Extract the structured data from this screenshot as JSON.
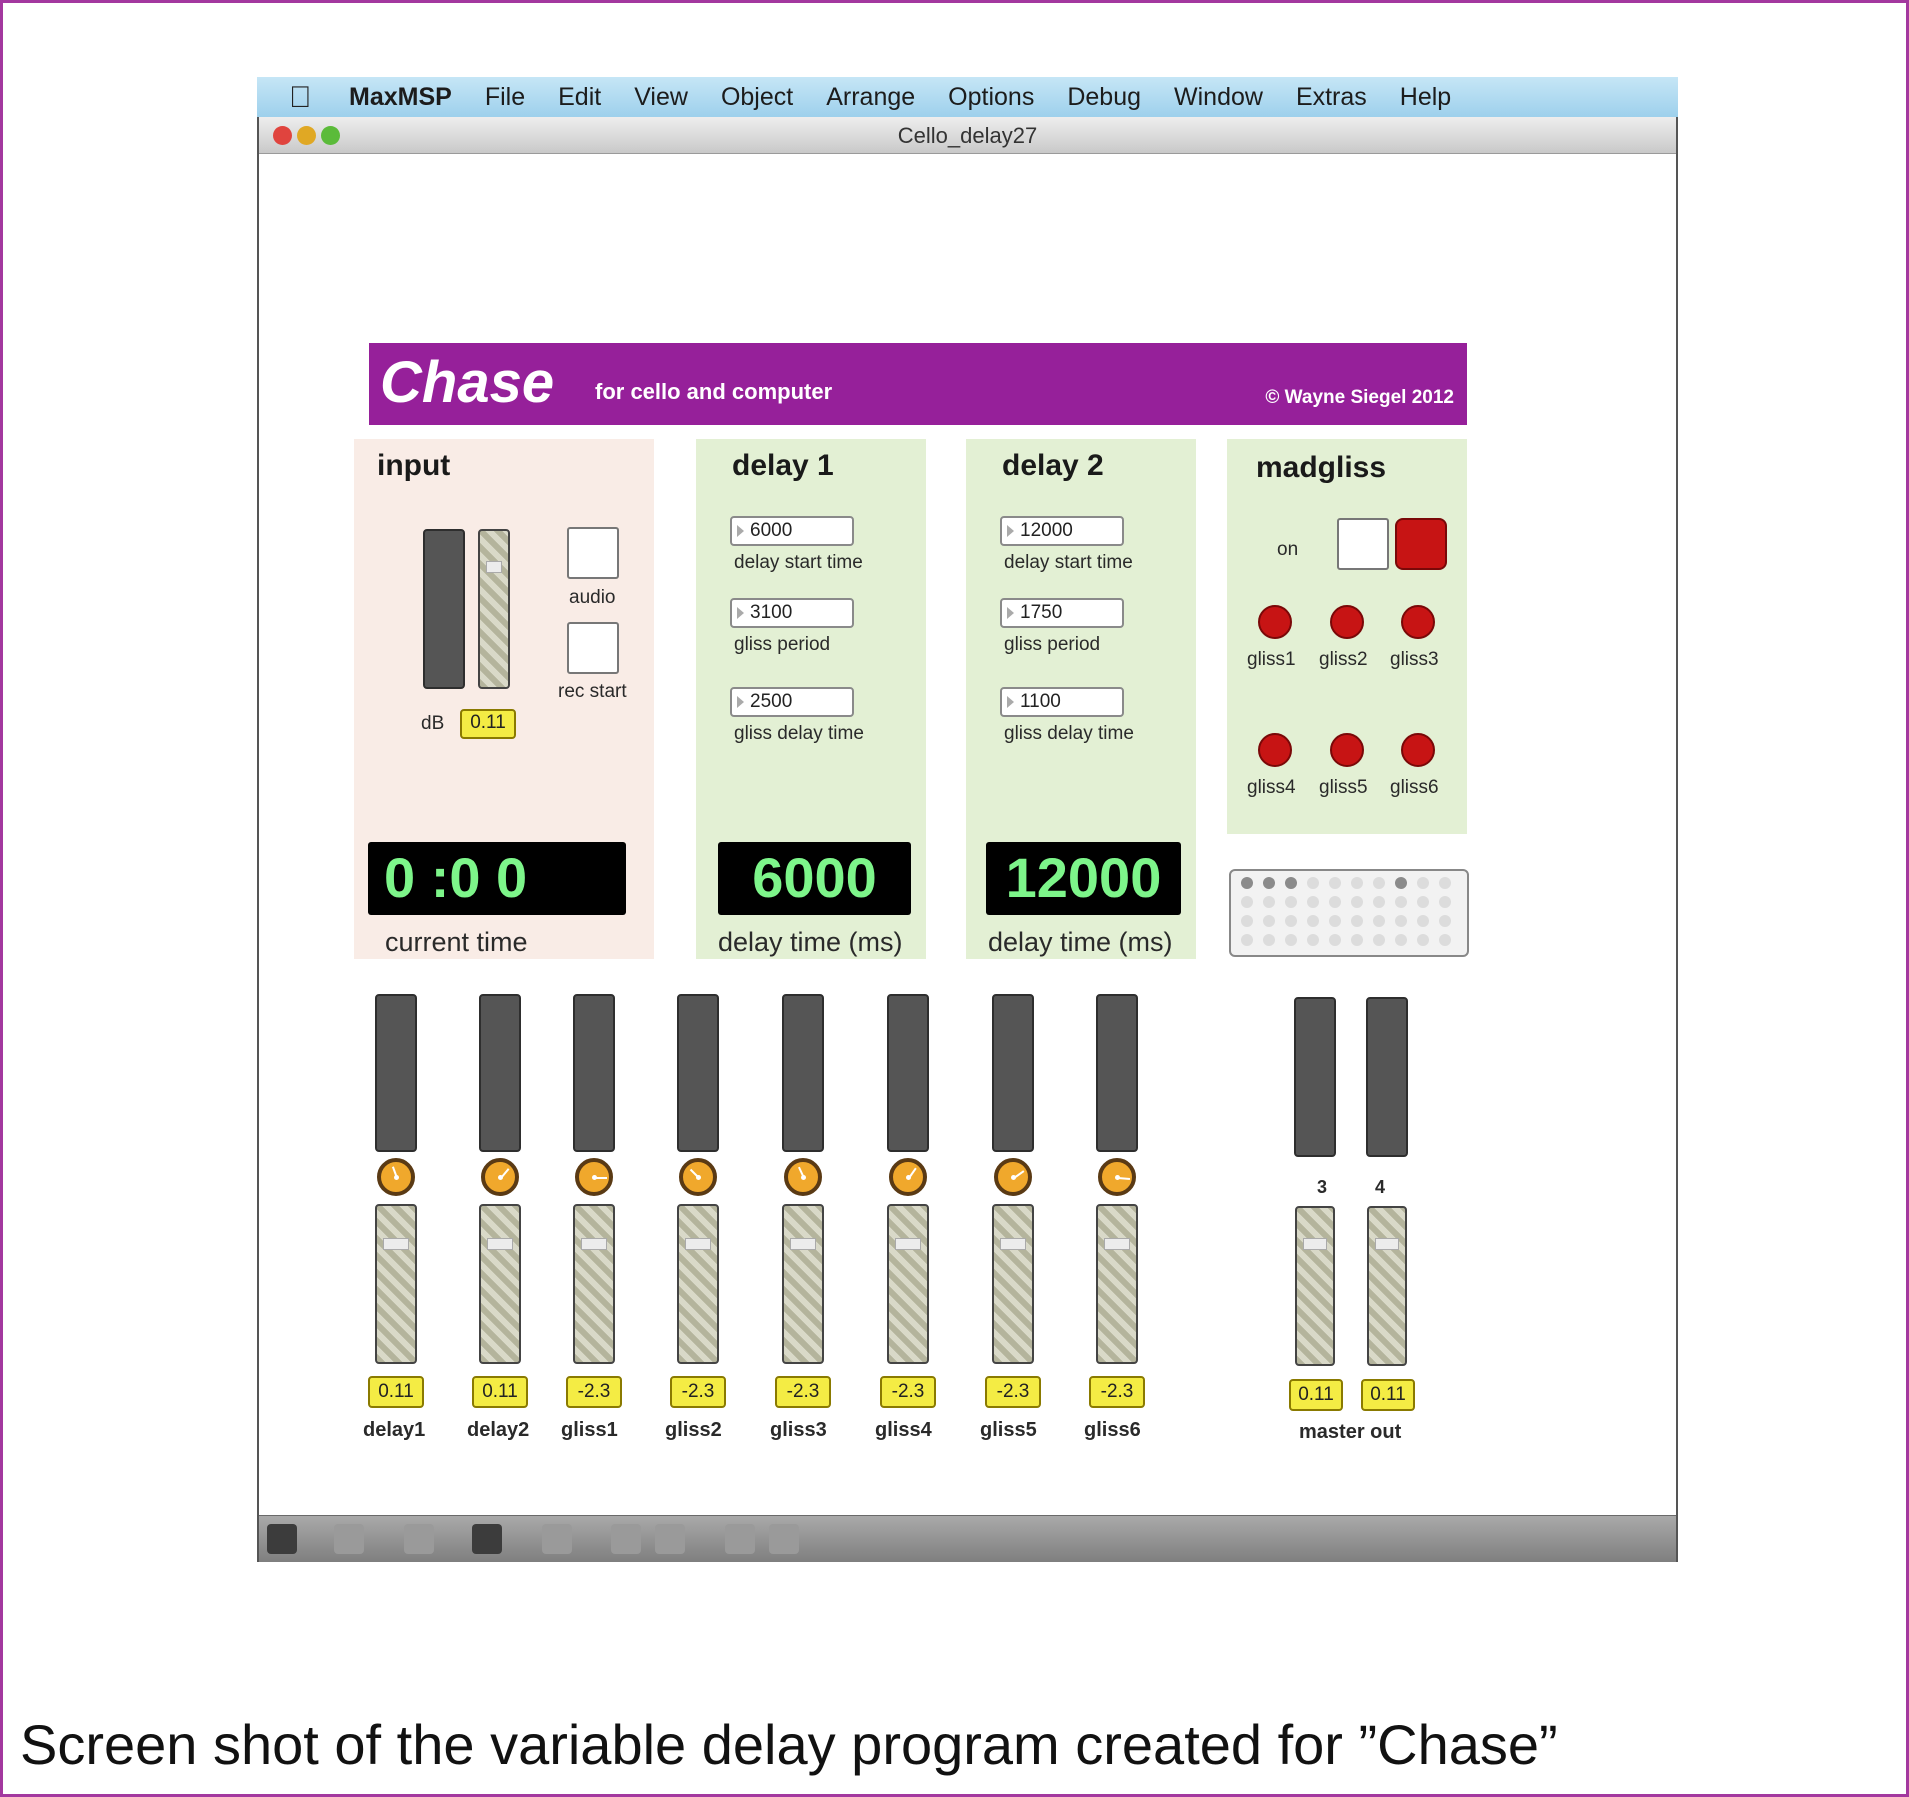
{
  "menubar": {
    "app": "MaxMSP",
    "items": [
      "File",
      "Edit",
      "View",
      "Object",
      "Arrange",
      "Options",
      "Debug",
      "Window",
      "Extras",
      "Help"
    ]
  },
  "window": {
    "title": "Cello_delay27"
  },
  "banner": {
    "title": "Chase",
    "subtitle": "for cello and computer",
    "copyright": "© Wayne Siegel 2012"
  },
  "input": {
    "heading": "input",
    "db_label": "dB",
    "db_value": "0.11",
    "audio_label": "audio",
    "rec_label": "rec start",
    "time_display": "0 :0  0",
    "time_label": "current time"
  },
  "delay1": {
    "heading": "delay 1",
    "start": "6000",
    "start_label": "delay start time",
    "period": "3100",
    "period_label": "gliss period",
    "gdelay": "2500",
    "gdelay_label": "gliss delay time",
    "display": "6000",
    "display_label": "delay time (ms)"
  },
  "delay2": {
    "heading": "delay 2",
    "start": "12000",
    "start_label": "delay start time",
    "period": "1750",
    "period_label": "gliss period",
    "gdelay": "1100",
    "gdelay_label": "gliss delay time",
    "display": "12000",
    "display_label": "delay time (ms)"
  },
  "madgliss": {
    "heading": "madgliss",
    "on_label": "on",
    "buttons": [
      "gliss1",
      "gliss2",
      "gliss3",
      "gliss4",
      "gliss5",
      "gliss6"
    ]
  },
  "mixer": {
    "channels": [
      {
        "label": "delay1",
        "value": "0.11"
      },
      {
        "label": "delay2",
        "value": "0.11"
      },
      {
        "label": "gliss1",
        "value": "-2.3"
      },
      {
        "label": "gliss2",
        "value": "-2.3"
      },
      {
        "label": "gliss3",
        "value": "-2.3"
      },
      {
        "label": "gliss4",
        "value": "-2.3"
      },
      {
        "label": "gliss5",
        "value": "-2.3"
      },
      {
        "label": "gliss6",
        "value": "-2.3"
      }
    ],
    "master": {
      "label": "master out",
      "ch3": "3",
      "ch4": "4",
      "value3": "0.11",
      "value4": "0.11"
    }
  },
  "caption": "Screen shot of the variable delay program created for ”Chase”",
  "colors": {
    "banner": "#96209a",
    "led_text": "#7df58a",
    "valbox": "#f4ec44",
    "input_panel": "#f9ece6",
    "delay_panel": "#e3f0d4"
  }
}
